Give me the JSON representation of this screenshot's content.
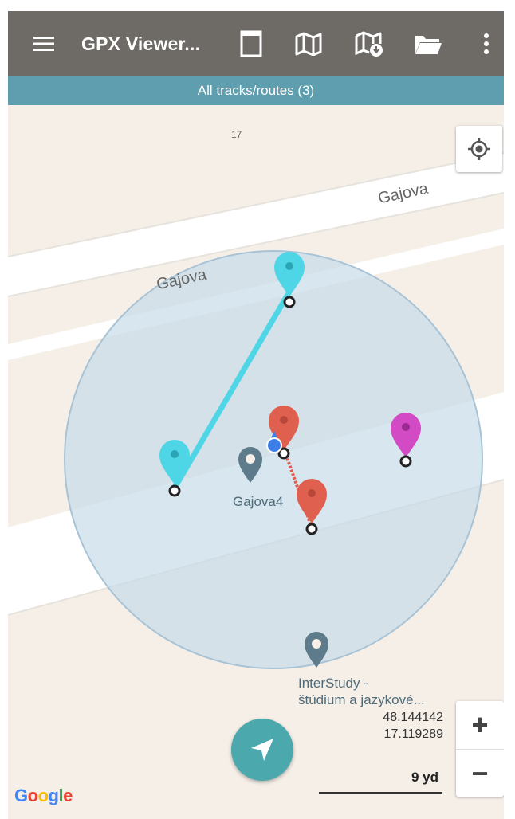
{
  "toolbar": {
    "title": "GPX Viewer...",
    "icons": [
      "menu-icon",
      "page-icon",
      "map-icon",
      "offline-map-icon",
      "folder-icon",
      "more-vert-icon"
    ],
    "color": "#6e6a66"
  },
  "subbar": {
    "text": "All tracks/routes (3)",
    "color": "#5e9eae"
  },
  "map": {
    "tile_label": "17",
    "streets": [
      "Gajova",
      "Gajova"
    ],
    "poi": [
      {
        "name": "Gajova4"
      },
      {
        "name": "InterStudy -\nštúdium a jazykové..."
      }
    ],
    "coordinates": {
      "lat": "48.144142",
      "lon": "17.119289"
    },
    "scale_label": "9 yd",
    "attribution": "Google",
    "colors": {
      "track_cyan": "#4fd6e6",
      "track_red": "#e0604f",
      "marker_magenta": "#d24bc4",
      "accuracy_circle": "#c6dbe8",
      "background": "#f5efe8"
    }
  },
  "zoom": {
    "in": "+",
    "out": "−"
  }
}
